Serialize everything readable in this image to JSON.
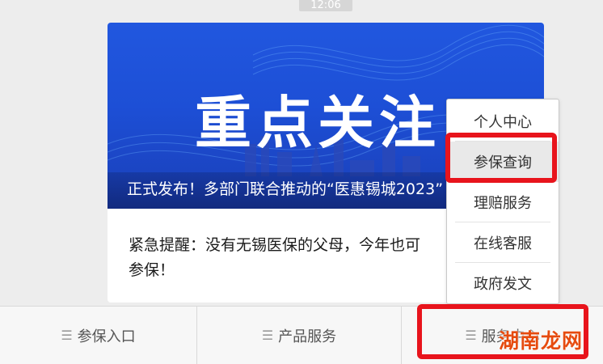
{
  "status": {
    "time": "12:06"
  },
  "article": {
    "banner_heading": "重点关注",
    "banner_caption": "正式发布！多部门联合推动的“医惠锡城2023”",
    "title_line1": "紧急提醒：没有无锡医保的父母，今年也可",
    "title_line2": "参保！"
  },
  "tabbar": {
    "tabs": [
      {
        "label": "参保入口"
      },
      {
        "label": "产品服务"
      },
      {
        "label": "服务中心"
      }
    ]
  },
  "popup_menu": {
    "items": [
      {
        "label": "个人中心"
      },
      {
        "label": "参保查询"
      },
      {
        "label": "理赔服务"
      },
      {
        "label": "在线客服"
      },
      {
        "label": "政府发文"
      }
    ]
  },
  "watermark": "湖南龙网",
  "colors": {
    "highlight": "#e8141c",
    "banner_blue": "#1d4fd6"
  }
}
